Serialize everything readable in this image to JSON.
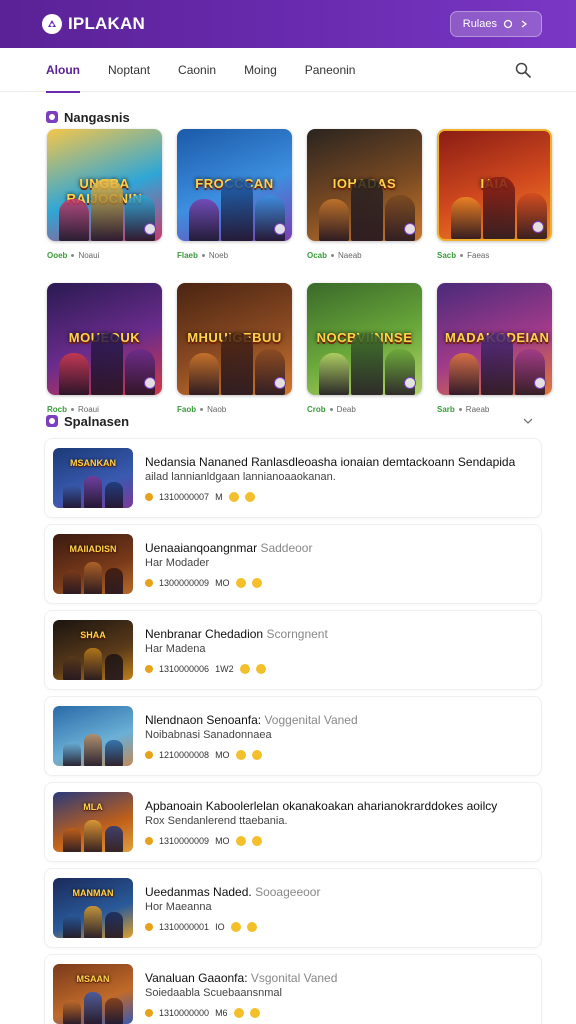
{
  "header": {
    "brand": "IPLAKAN",
    "button_label": "Rulaes"
  },
  "tabs": [
    {
      "label": "Aloun",
      "active": true
    },
    {
      "label": "Noptant",
      "active": false
    },
    {
      "label": "Caonin",
      "active": false
    },
    {
      "label": "Moing",
      "active": false
    },
    {
      "label": "Paneonin",
      "active": false
    }
  ],
  "section1": {
    "title": "Nangasnis"
  },
  "grid": [
    {
      "title": "UNGBA RAIJOCNIN",
      "price": "Ooeb",
      "label": "Noaui",
      "colors": [
        "#f5c64a",
        "#2fa6d6",
        "#c93a6e"
      ],
      "featured": false
    },
    {
      "title": "FROCCCAN",
      "price": "Flaeb",
      "label": "Noeb",
      "colors": [
        "#1b5aa8",
        "#3d8fe0",
        "#7a3fb0"
      ],
      "featured": false
    },
    {
      "title": "IOHADAS",
      "price": "Ocab",
      "label": "Naeab",
      "colors": [
        "#2a2420",
        "#7a4a22",
        "#c9782c"
      ],
      "featured": false
    },
    {
      "title": "IAIA",
      "price": "Sacb",
      "label": "Faeas",
      "colors": [
        "#8a1d14",
        "#d24a1f",
        "#f08a24"
      ],
      "featured": true
    },
    {
      "title": "MOUEOUK",
      "price": "Rocb",
      "label": "Roaui",
      "colors": [
        "#2a1a52",
        "#6a2c8c",
        "#d13a4a"
      ],
      "featured": false
    },
    {
      "title": "MHUUIGEBUU",
      "price": "Faob",
      "label": "Naob",
      "colors": [
        "#4a2412",
        "#8a4a22",
        "#d0782c"
      ],
      "featured": false
    },
    {
      "title": "NOCBVIINNSE",
      "price": "Crob",
      "label": "Deab",
      "colors": [
        "#3a6a2a",
        "#6aa83a",
        "#b8d46a"
      ],
      "featured": false
    },
    {
      "title": "MADAKODEIAN",
      "price": "Sarb",
      "label": "Raeab",
      "colors": [
        "#4a2a7a",
        "#a03a8a",
        "#e07a3a"
      ],
      "featured": false
    }
  ],
  "section2": {
    "title": "Spalnasen"
  },
  "list": [
    {
      "thumb_title": "MSANKAN",
      "title": "Nedansia Nananed Ranlasdleoasha ionaian demtackoann Sendapida",
      "hint": "",
      "subtitle": "ailad lannianldgaan lannianoaaokanan.",
      "stats": "1310000007",
      "count": "M",
      "colors": [
        "#1b3a78",
        "#3a5ab0",
        "#7a3a9a"
      ]
    },
    {
      "thumb_title": "MAIIADISN",
      "title": "Uenaaianqoangnmar",
      "hint": "Saddeoor",
      "subtitle": "Har Modader",
      "stats": "1300000009",
      "count": "MO",
      "colors": [
        "#3a1a10",
        "#7a3a1a",
        "#b86a2a"
      ]
    },
    {
      "thumb_title": "SHAA",
      "title": "Nenbranar Chedadion",
      "hint": "Scorngnent",
      "subtitle": "Har Madena",
      "stats": "1310000006",
      "count": "1W2",
      "colors": [
        "#1a1410",
        "#5a3a1a",
        "#c0801a"
      ]
    },
    {
      "thumb_title": "",
      "title": "Nlendnaon Senoanfa:",
      "hint": "Voggenital Vaned",
      "subtitle": "Noibabnasi Sanadonnaea",
      "stats": "1210000008",
      "count": "MO",
      "colors": [
        "#2a6aa8",
        "#6ab0d6",
        "#c08a5a"
      ]
    },
    {
      "thumb_title": "MLA",
      "title": "Apbanoain Kaboolerlelan okanakoakan aharianokrarddokes aoilcy",
      "hint": "",
      "subtitle": "Rox Sendanlerend ttaebania.",
      "stats": "1310000009",
      "count": "MO",
      "colors": [
        "#2a3a7a",
        "#c0601a",
        "#e0a03a"
      ]
    },
    {
      "thumb_title": "MANMAN",
      "title": "Ueedanmas Naded.",
      "hint": "Sooageeoor",
      "subtitle": "Hor Maeanna",
      "stats": "1310000001",
      "count": "IO",
      "colors": [
        "#1a2a5a",
        "#2a5a9a",
        "#e0a02a"
      ]
    },
    {
      "thumb_title": "MSAAN",
      "title": "Vanaluan Gaaonfa:",
      "hint": "Vsgonital Vaned",
      "subtitle": "Soiedaabla Scuebaansnmal",
      "stats": "1310000000",
      "count": "M6",
      "colors": [
        "#7a3a1a",
        "#c06a2a",
        "#3a5ab0"
      ]
    }
  ]
}
